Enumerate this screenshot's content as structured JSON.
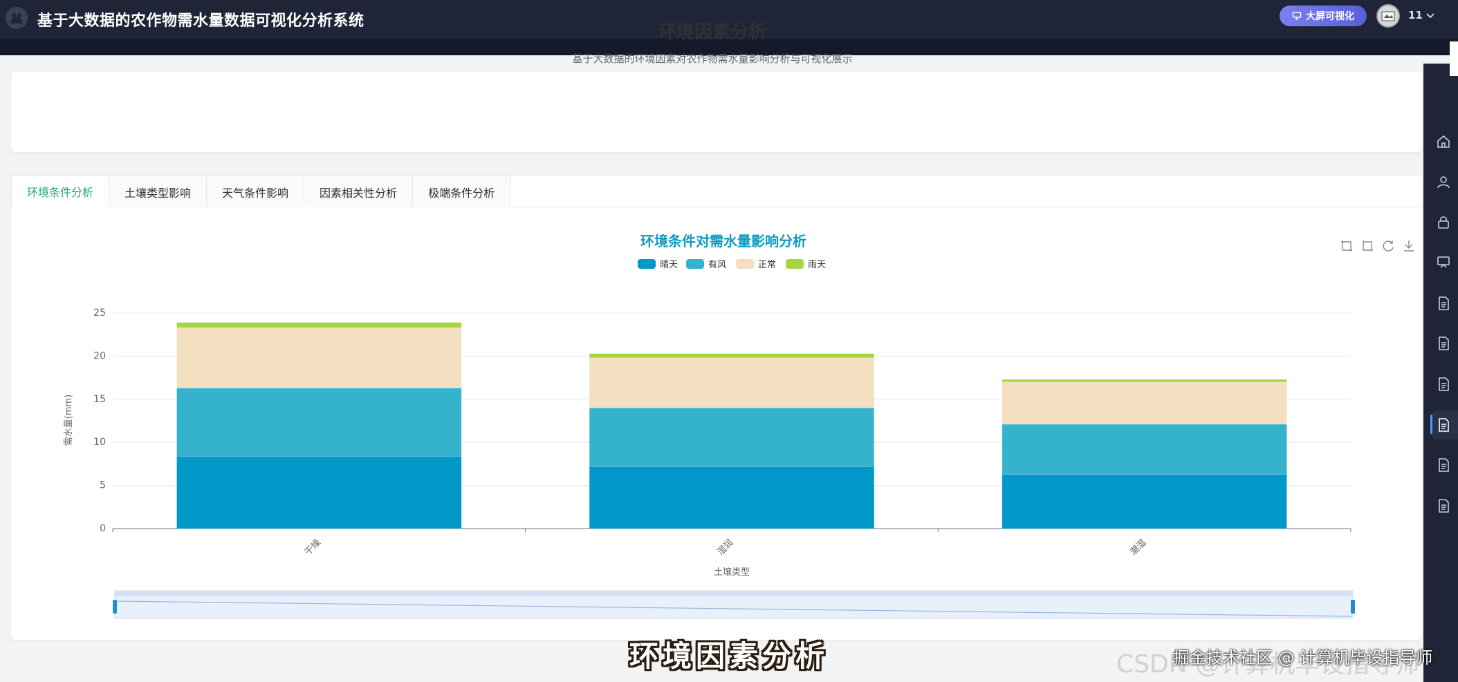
{
  "app": {
    "title": "基于大数据的农作物需水量数据可视化分析系统"
  },
  "header": {
    "bigscreen_label": "大屏可视化",
    "username": "11"
  },
  "page": {
    "title": "环境因素分析",
    "subtitle": "基于大数据的环境因素对农作物需水量影响分析与可视化展示"
  },
  "tabs": [
    {
      "label": "环境条件分析",
      "active": true
    },
    {
      "label": "土壤类型影响",
      "active": false
    },
    {
      "label": "天气条件影响",
      "active": false
    },
    {
      "label": "因素相关性分析",
      "active": false
    },
    {
      "label": "极端条件分析",
      "active": false
    }
  ],
  "colors": {
    "accent_tab": "#1ea586",
    "chart_title": "#0e9bc4",
    "header_bg": "#1f2537"
  },
  "icons": {
    "logo": "github-cat-icon",
    "bigscreen": "monitor-icon",
    "toolbox": [
      "zoom-icon",
      "zoom-reset-icon",
      "restore-icon",
      "download-icon"
    ],
    "sidebar": [
      "home-icon",
      "user-icon",
      "lock-icon",
      "screen-icon",
      "document-icon",
      "document-icon",
      "document-icon",
      "document-icon",
      "document-icon",
      "document-icon"
    ]
  },
  "chart_data": {
    "type": "bar",
    "stacked": true,
    "title": "环境条件对需水量影响分析",
    "xlabel": "土壤类型",
    "ylabel": "需水量(mm)",
    "categories": [
      "干燥",
      "湿润",
      "潮湿"
    ],
    "ylim": [
      0,
      25
    ],
    "yticks": [
      0,
      5,
      10,
      15,
      20,
      25
    ],
    "legend_position": "top-center",
    "grid": true,
    "dataZoom": true,
    "series": [
      {
        "name": "晴天",
        "color": "#0098c9",
        "values": [
          8.4,
          7.2,
          6.3
        ]
      },
      {
        "name": "有风",
        "color": "#35b2cc",
        "values": [
          7.9,
          6.8,
          5.8
        ]
      },
      {
        "name": "正常",
        "color": "#f4dfc0",
        "values": [
          7.0,
          5.8,
          4.9
        ]
      },
      {
        "name": "雨天",
        "color": "#a5d63f",
        "values": [
          0.6,
          0.5,
          0.3
        ]
      }
    ]
  },
  "overlay": {
    "caption": "环境因素分析",
    "watermark_csdn": "CSDN @计算机毕设指导师",
    "watermark_juejin": "掘金技术社区 @ 计算机毕设指导师"
  }
}
